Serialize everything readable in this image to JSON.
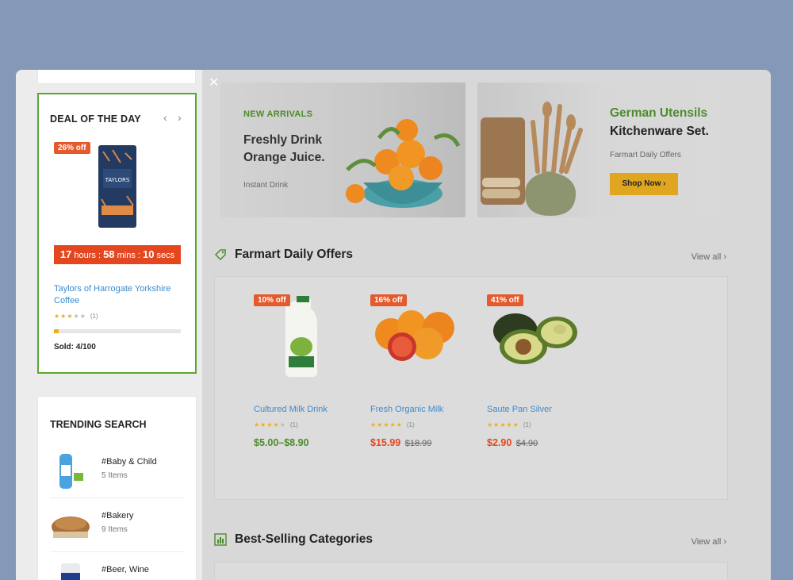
{
  "close": {
    "symbol": "✕"
  },
  "deal": {
    "title": "DEAL OF THE DAY",
    "prev": "‹",
    "next": "›",
    "badge": "26% off",
    "timer": {
      "hours": "17",
      "hours_label": "hours",
      "mins": "58",
      "mins_label": "mins",
      "secs": "10",
      "secs_label": "secs",
      "sep": ":"
    },
    "product_name": "Taylors of Harrogate Yorkshire Coffee",
    "rating": 3,
    "rating_count": "(1)",
    "sold_fraction": 0.04,
    "sold_text": "Sold: 4/100"
  },
  "trending": {
    "title": "TRENDING SEARCH",
    "items": [
      {
        "name": "#Baby & Child",
        "count": "5 Items"
      },
      {
        "name": "#Bakery",
        "count": "9 Items"
      },
      {
        "name": "#Beer, Wine",
        "count": ""
      }
    ]
  },
  "banners": [
    {
      "eyebrow": "NEW ARRIVALS",
      "title_line1": "Freshly Drink",
      "title_line2": "Orange Juice.",
      "subtitle": "Instant Drink"
    },
    {
      "title_line1": "German Utensils",
      "title_line2": "Kitchenware Set.",
      "subtitle": "Farmart Daily Offers",
      "button": "Shop Now ›"
    }
  ],
  "offers": {
    "title": "Farmart Daily Offers",
    "view_all": "View all ›",
    "products": [
      {
        "badge": "10% off",
        "name": "Cultured Milk Drink",
        "rating": 4,
        "rating_count": "(1)",
        "price": "$5.00–$8.90",
        "old_price": ""
      },
      {
        "badge": "16% off",
        "name": "Fresh Organic Milk",
        "rating": 5,
        "rating_count": "(1)",
        "price": "$15.99",
        "old_price": "$18.99"
      },
      {
        "badge": "41% off",
        "name": "Saute Pan Silver",
        "rating": 5,
        "rating_count": "(1)",
        "price": "$2.90",
        "old_price": "$4.90"
      }
    ]
  },
  "best_selling": {
    "title": "Best-Selling Categories",
    "view_all": "View all ›"
  },
  "colors": {
    "accent_green": "#4b8c2b",
    "badge_orange": "#e45a2c",
    "link_blue": "#3a8bcf",
    "star": "#f0ad1b",
    "overlay_bg": "#8499b8"
  }
}
